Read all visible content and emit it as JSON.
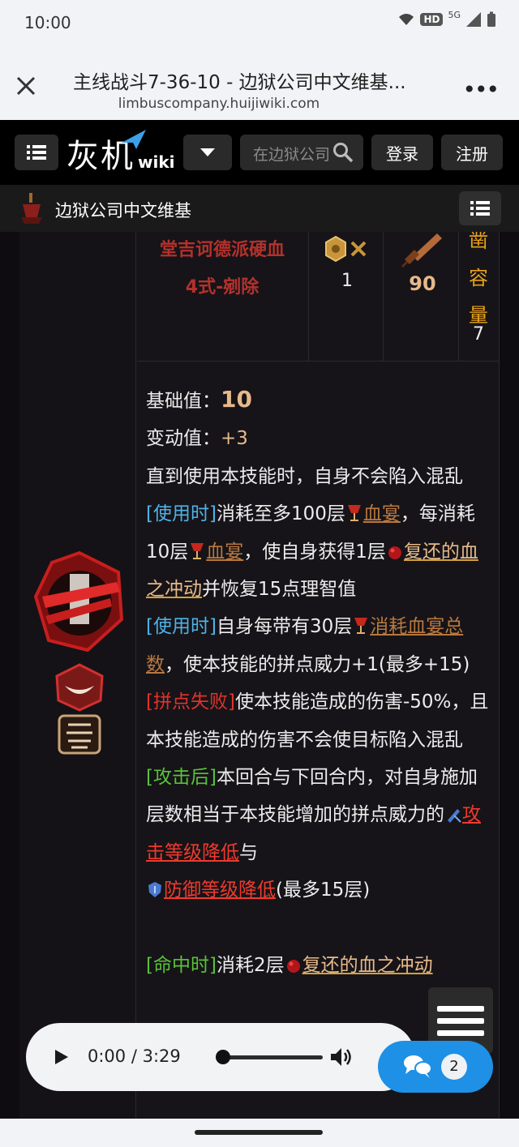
{
  "status": {
    "time": "10:00",
    "hd": "HD",
    "network": "5G"
  },
  "browser": {
    "title": "主线战斗7-36-10 - 边狱公司中文维基...",
    "url": "limbuscompany.huijiwiki.com"
  },
  "header": {
    "logo_text": "灰机",
    "logo_wiki": "wiki",
    "search_placeholder": "在边狱公司中文维基内搜索",
    "login": "登录",
    "register": "注册"
  },
  "site": {
    "name": "边狱公司中文维基"
  },
  "skill": {
    "name_line1": "堂吉诃德派硬血",
    "name_line2": "4式-剜除",
    "coin_count": "1",
    "attack_weight": "90",
    "capacity_label": [
      "凿",
      "容",
      "量"
    ],
    "capacity_value": "7"
  },
  "desc": {
    "base_label": "基础值：",
    "base_value": "10",
    "var_label": "变动值：",
    "var_value": "+3",
    "line_a": "直到使用本技能时，自身不会陷入混乱",
    "on_use": "[使用时]",
    "use_text1": "消耗至多100层",
    "feast1": "血宴",
    "use_text2": "，每消耗10层",
    "feast2": "血宴",
    "use_text3": "，使自身获得1层",
    "blood_urge1": "复还的血之冲动",
    "use_text4": "并恢复15点理智值",
    "on_use2": "[使用时]",
    "use2_text1": "自身每带有30层",
    "feast_total": "消耗血宴总数",
    "use2_text2": "，使本技能的拼点威力+1(最多+15)",
    "clash_lose": "[拼点失败]",
    "clash_text": "使本技能造成的伤害-50%，且本技能造成的伤害不会使目标陷入混乱",
    "after_atk": "[攻击后]",
    "after_text1": "本回合与下回合内，对自身施加层数相当于本技能增加的拼点威力的",
    "atk_down": "攻击等级降低",
    "after_text2": "与",
    "def_down": "防御等级降低",
    "after_text3": "(最多15层)",
    "on_hit": "[命中时]",
    "hit_text1": "消耗2层",
    "blood_urge2": "复还的血之冲动"
  },
  "audio": {
    "time": "0:00 / 3:29",
    "progress": 0
  },
  "chat": {
    "count": "2"
  },
  "colors": {
    "cyan_tag": "#4fb2e8",
    "red_tag": "#e0322c",
    "green_tag": "#59c23a",
    "accent_gold": "#e8a21a",
    "skill_red": "#b3312c"
  }
}
